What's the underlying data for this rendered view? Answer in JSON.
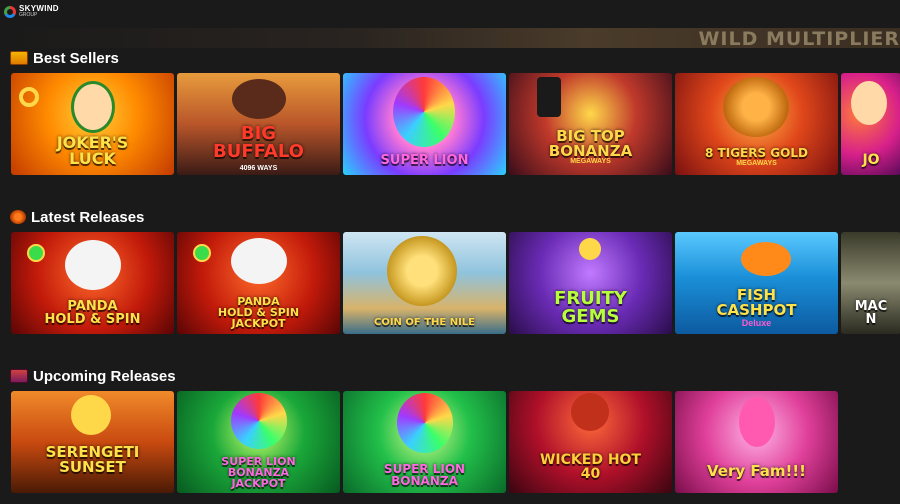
{
  "brand": {
    "name": "SKYWIND",
    "subtitle": "GROUP"
  },
  "hero": {
    "text": "WILD MULTIPLIER"
  },
  "sections": [
    {
      "title": "Best Sellers",
      "icon": "treasure-chest-icon",
      "games": [
        {
          "title": "JOKER'S\nLUCK",
          "subtitle": "",
          "color": "#ffe14a"
        },
        {
          "title": "BIG\nBUFFALO",
          "subtitle": "4096 WAYS",
          "color": "#ff3a2a"
        },
        {
          "title": "SUPER LION",
          "subtitle": "",
          "color": "#ff66e0"
        },
        {
          "title": "BIG TOP\nBONANZA",
          "subtitle": "MEGAWAYS",
          "color": "#ffd84a"
        },
        {
          "title": "8 TIGERS GOLD",
          "subtitle": "MEGAWAYS",
          "color": "#ffd84a"
        },
        {
          "title": "JO",
          "subtitle": "",
          "color": "#ffe14a"
        }
      ]
    },
    {
      "title": "Latest Releases",
      "icon": "fireball-icon",
      "games": [
        {
          "title": "PANDA\nHOLD & SPIN",
          "subtitle": "",
          "color": "#ffe14a"
        },
        {
          "title": "PANDA\nHOLD & SPIN\nJACKPOT",
          "subtitle": "",
          "color": "#ffe14a"
        },
        {
          "title": "COIN OF THE NILE",
          "subtitle": "",
          "color": "#ffd84a"
        },
        {
          "title": "FRUITY\nGEMS",
          "subtitle": "",
          "color": "#b6ff3a"
        },
        {
          "title": "FISH\nCASHPOT",
          "subtitle": "Deluxe",
          "color": "#ffe14a"
        },
        {
          "title": "MAC\nN",
          "subtitle": "",
          "color": "#ffffff"
        }
      ]
    },
    {
      "title": "Upcoming Releases",
      "icon": "treasure-chest-icon",
      "games": [
        {
          "title": "SERENGETI\nSUNSET",
          "subtitle": "",
          "color": "#ffe14a"
        },
        {
          "title": "SUPER LION\nBONANZA\nJACKPOT",
          "subtitle": "",
          "color": "#ff66e0"
        },
        {
          "title": "SUPER LION\nBONANZA",
          "subtitle": "",
          "color": "#ff66e0"
        },
        {
          "title": "WICKED HOT\n40",
          "subtitle": "",
          "color": "#ffcf3a"
        },
        {
          "title": "Very Fam!!!",
          "subtitle": "",
          "color": "#ffe14a"
        }
      ]
    }
  ]
}
